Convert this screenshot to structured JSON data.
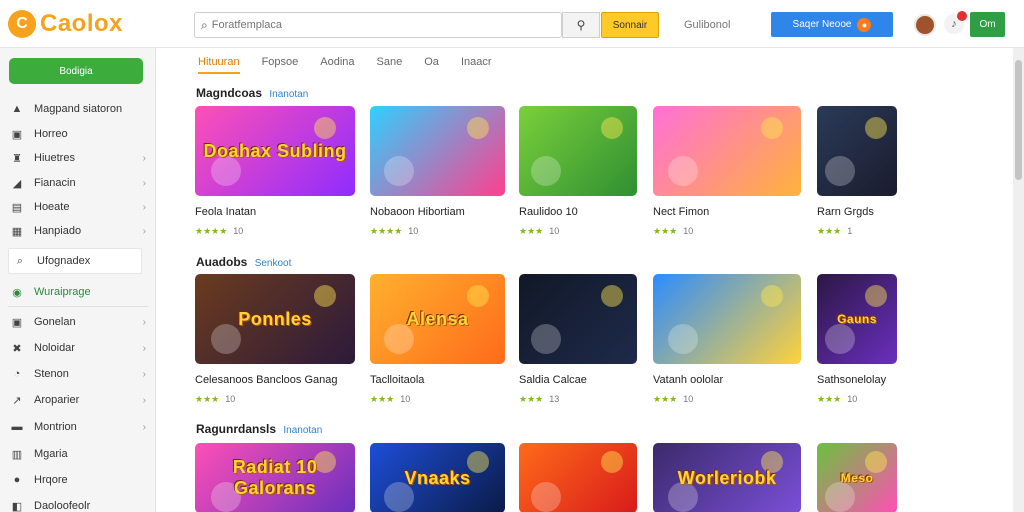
{
  "header": {
    "logo_mark": "C",
    "logo_text": "Caolox",
    "search_placeholder": "Foratfemplaca",
    "submit_label": "Sonnair",
    "top_link": "Gulibonol",
    "signin_label": "Saqer Neooe",
    "go_label": "Om"
  },
  "sidebar": {
    "primary_button": "Bodigia",
    "search_label": "Ufognadex",
    "items": [
      {
        "label": "Magpand siatoron",
        "icon": "star"
      },
      {
        "label": "Horreo",
        "icon": "home"
      },
      {
        "label": "Hiuetres",
        "icon": "trophy"
      },
      {
        "label": "Fianacin",
        "icon": "chart"
      },
      {
        "label": "Hoeate",
        "icon": "folder"
      },
      {
        "label": "Hanpiado",
        "icon": "clipboard"
      },
      {
        "label": "Wuraiprage",
        "icon": "globe"
      },
      {
        "label": "Gonelan",
        "icon": "grid"
      },
      {
        "label": "Noloidar",
        "icon": "tools"
      },
      {
        "label": "Stenon",
        "icon": "clock"
      },
      {
        "label": "Aroparier",
        "icon": "trend"
      },
      {
        "label": "Montrion",
        "icon": "monitor"
      },
      {
        "label": "Mgaria",
        "icon": "box"
      },
      {
        "label": "Hrqore",
        "icon": "circle"
      },
      {
        "label": "Daoloofeolr",
        "icon": "layers"
      }
    ]
  },
  "tabs": [
    "Hituuran",
    "Fopsoe",
    "Aodina",
    "Sane",
    "Oa",
    "Inaacr"
  ],
  "sections": [
    {
      "title": "Magndcoas",
      "link": "Inanotan",
      "cards": [
        {
          "title": "Feola Inatan",
          "stars": "★★★★",
          "count": "10",
          "caption": "Doahax Subling",
          "colors": [
            "#ff4fb6",
            "#8f2cff"
          ]
        },
        {
          "title": "Nobaoon Hibortiam",
          "stars": "★★★★",
          "count": "10",
          "caption": "",
          "colors": [
            "#2fd0ff",
            "#ff3f8e"
          ]
        },
        {
          "title": "Raulidoo 10",
          "stars": "★★★",
          "count": "10",
          "caption": "",
          "colors": [
            "#7ad03a",
            "#2f8f33"
          ]
        },
        {
          "title": "Nect Fimon",
          "stars": "★★★",
          "count": "10",
          "caption": "",
          "colors": [
            "#ff6fd8",
            "#ffb23b"
          ]
        },
        {
          "title": "Rarn Grgds",
          "stars": "★★★",
          "count": "1",
          "caption": "",
          "colors": [
            "#2a3b58",
            "#1b1b2e"
          ]
        }
      ]
    },
    {
      "title": "Auadobs",
      "link": "Senkoot",
      "cards": [
        {
          "title": "Celesanoos Bancloos Ganag",
          "stars": "★★★",
          "count": "10",
          "caption": "Ponnles",
          "colors": [
            "#6b3b1e",
            "#2c1a3b"
          ]
        },
        {
          "title": "Taclloitaola",
          "stars": "★★★",
          "count": "10",
          "caption": "Alensa",
          "colors": [
            "#ffb02e",
            "#ff6b1a"
          ]
        },
        {
          "title": "Saldia Calcae",
          "stars": "★★★",
          "count": "13",
          "caption": "",
          "colors": [
            "#111827",
            "#1e2a4a"
          ]
        },
        {
          "title": "Vatanh oololar",
          "stars": "★★★",
          "count": "10",
          "caption": "",
          "colors": [
            "#2c8cff",
            "#ffd23b"
          ]
        },
        {
          "title": "Sathsonelolay",
          "stars": "★★★",
          "count": "10",
          "caption": "Gauns",
          "colors": [
            "#2b1745",
            "#6a2fbf"
          ]
        }
      ]
    },
    {
      "title": "Ragunrdansls",
      "link": "Inanotan",
      "cards": [
        {
          "title": "",
          "stars": "",
          "count": "",
          "caption": "Radiat 10 Galorans",
          "colors": [
            "#ff4fb6",
            "#6a2fbf"
          ]
        },
        {
          "title": "",
          "stars": "",
          "count": "",
          "caption": "Vnaaks",
          "colors": [
            "#1d4ed8",
            "#0b1b47"
          ]
        },
        {
          "title": "",
          "stars": "",
          "count": "",
          "caption": "",
          "colors": [
            "#ff6a1a",
            "#d81b1b"
          ]
        },
        {
          "title": "",
          "stars": "",
          "count": "",
          "caption": "Worleriobk",
          "colors": [
            "#3b2a6b",
            "#7a4fd8"
          ]
        },
        {
          "title": "",
          "stars": "",
          "count": "",
          "caption": "Meso",
          "colors": [
            "#6ac23b",
            "#ff4fb6"
          ]
        }
      ]
    }
  ]
}
